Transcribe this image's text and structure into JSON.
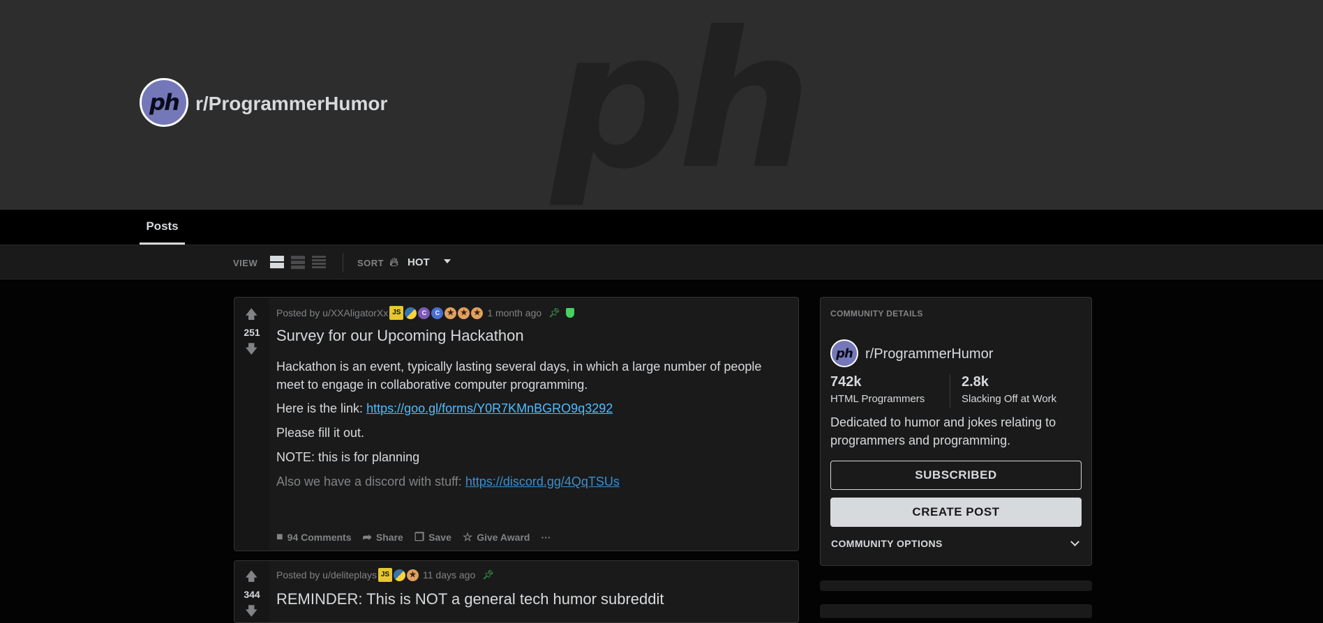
{
  "banner": {
    "watermark": "ph"
  },
  "subreddit": {
    "avatar_text": "ph",
    "name": "r/ProgrammerHumor"
  },
  "tabs": [
    {
      "label": "Posts",
      "active": true
    }
  ],
  "toolbar": {
    "view_label": "VIEW",
    "sort_label": "SORT",
    "sort_value": "HOT",
    "view_modes": [
      "card",
      "classic",
      "compact"
    ],
    "sort_icon": "flame-icon"
  },
  "posts": [
    {
      "score": "251",
      "meta_prefix": "Posted by u/XXAligatorXx",
      "flairs": [
        "JS",
        "python",
        "C",
        "C",
        "sk",
        "sk",
        "sk"
      ],
      "time": "1 month ago",
      "title": "Survey for our Upcoming Hackathon",
      "p1": "Hackathon is an event, typically lasting several days, in which a large number of people meet to engage in collaborative computer programming.",
      "p2_prefix": "Here is the link: ",
      "p2_link": "https://goo.gl/forms/Y0R7KMnBGRO9q3292",
      "p3": "Please fill it out.",
      "p4": "NOTE: this is for planning",
      "p5_prefix": "Also we have a discord with stuff: ",
      "p5_link": "https://discord.gg/4QqTSUs",
      "actions": {
        "comments": "94 Comments",
        "share": "Share",
        "save": "Save",
        "award": "Give Award",
        "more": "···"
      }
    },
    {
      "score": "344",
      "meta_prefix": "Posted by u/deliteplays",
      "flairs": [
        "JS",
        "python",
        "sk"
      ],
      "time": "11 days ago",
      "title": "REMINDER: This is NOT a general tech humor subreddit"
    }
  ],
  "sidebar": {
    "header": "COMMUNITY DETAILS",
    "avatar_text": "ph",
    "name": "r/ProgrammerHumor",
    "stats": [
      {
        "value": "742k",
        "label": "HTML Programmers"
      },
      {
        "value": "2.8k",
        "label": "Slacking Off at Work"
      }
    ],
    "description": "Dedicated to humor and jokes relating to programmers and programming.",
    "subscribed_label": "SUBSCRIBED",
    "create_post_label": "CREATE POST",
    "options_label": "COMMUNITY OPTIONS"
  },
  "colors": {
    "accent_link": "#4fbcff",
    "mod_green": "#46d160",
    "avatar_bg": "#7478b8"
  }
}
